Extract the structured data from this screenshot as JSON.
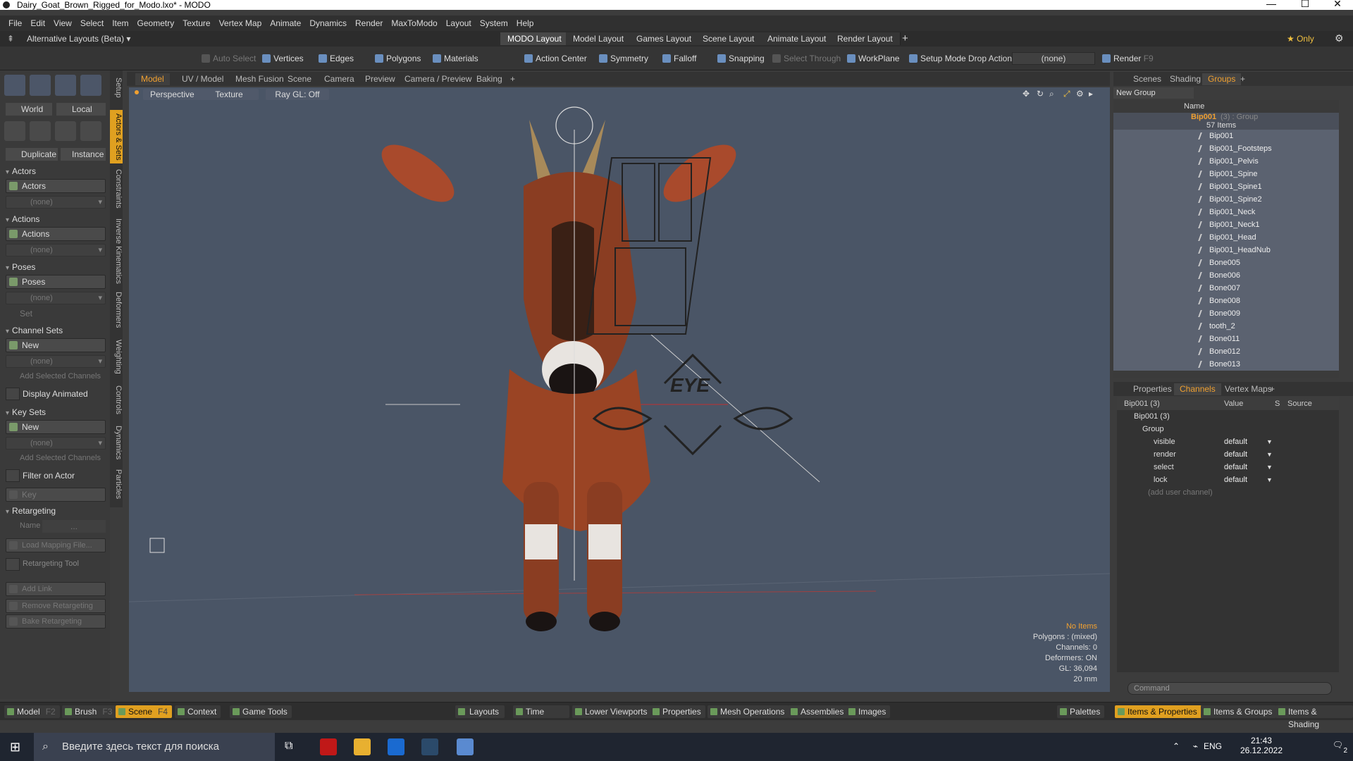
{
  "window": {
    "title": "Dairy_Goat_Brown_Rigged_for_Modo.lxo* - MODO",
    "minimize": "—",
    "maximize": "☐",
    "close": "✕"
  },
  "menu": [
    "File",
    "Edit",
    "View",
    "Select",
    "Item",
    "Geometry",
    "Texture",
    "Vertex Map",
    "Animate",
    "Dynamics",
    "Render",
    "MaxToModo",
    "Layout",
    "System",
    "Help"
  ],
  "layoutbar": {
    "alt": "Alternative Layouts (Beta) ▾",
    "tabs": [
      "MODO Layout",
      "Model Layout",
      "Games Layout",
      "Scene Layout",
      "Animate Layout",
      "Render Layout"
    ],
    "active": 0,
    "add": "+",
    "only": "★ Only"
  },
  "toolbar": {
    "auto_select": "Auto Select",
    "vertices": "Vertices",
    "edges": "Edges",
    "polygons": "Polygons",
    "materials": "Materials",
    "action_center": "Action Center",
    "symmetry": "Symmetry",
    "falloff": "Falloff",
    "snapping": "Snapping",
    "select_through": "Select Through",
    "workplane": "WorkPlane",
    "setup_mode": "Setup Mode",
    "drop_action": "Drop Action",
    "drop_value": "(none)",
    "render": "Render",
    "render_key": "F9"
  },
  "left": {
    "world": "World",
    "local": "Local",
    "duplicate": "Duplicate",
    "instance": "Instance",
    "actors_head": "Actors",
    "actors": "Actors",
    "none": "(none)",
    "actions_head": "Actions",
    "actions": "Actions",
    "poses_head": "Poses",
    "poses": "Poses",
    "set": "Set",
    "channel_sets_head": "Channel Sets",
    "new": "New",
    "add_selected": "Add Selected Channels",
    "display_animated": "Display Animated",
    "key_sets_head": "Key Sets",
    "key": "Key",
    "filter_actor": "Filter on Actor",
    "retargeting_head": "Retargeting",
    "name": "Name",
    "name_val": "...",
    "load_mapping": "Load Mapping File...",
    "retargeting_tool": "Retargeting Tool",
    "add_link": "Add Link",
    "remove_retargeting": "Remove Retargeting",
    "bake_retargeting": "Bake Retargeting"
  },
  "vtabs": [
    "Setup",
    "Actors & Sets",
    "Constraints",
    "Inverse Kinematics",
    "Deformers",
    "Weighting",
    "Controls",
    "Dynamics",
    "Particles"
  ],
  "viewtabs": [
    "Model",
    "UV / Model",
    "Mesh Fusion",
    "Scene",
    "Camera",
    "Preview",
    "Camera / Preview",
    "Baking"
  ],
  "viewport": {
    "perspective": "Perspective",
    "texture": "Texture",
    "raygl": "Ray GL: Off",
    "eye": "EYE",
    "info": {
      "no_items": "No Items",
      "polygons": "Polygons : (mixed)",
      "channels": "Channels: 0",
      "deformers": "Deformers: ON",
      "gl": "GL: 36,094",
      "scale": "20 mm"
    }
  },
  "right": {
    "tabs": [
      "Scenes",
      "Shading",
      "Groups"
    ],
    "new_group": "New Group",
    "col_name": "Name",
    "group": "Bip001",
    "group_meta": "(3) : Group",
    "items_count": "57 Items",
    "items": [
      "Bip001",
      "Bip001_Footsteps",
      "Bip001_Pelvis",
      "Bip001_Spine",
      "Bip001_Spine1",
      "Bip001_Spine2",
      "Bip001_Neck",
      "Bip001_Neck1",
      "Bip001_Head",
      "Bip001_HeadNub",
      "Bone005",
      "Bone006",
      "Bone007",
      "Bone008",
      "Bone009",
      "tooth_2",
      "Bone011",
      "Bone012",
      "Bone013"
    ]
  },
  "props": {
    "tabs": [
      "Properties",
      "Channels",
      "Vertex Maps"
    ],
    "cols": [
      "Bip001 (3)",
      "Value",
      "S",
      "Source"
    ],
    "rows": [
      {
        "n": "Bip001 (3)"
      },
      {
        "n": "Group"
      },
      {
        "n": "visible",
        "v": "default"
      },
      {
        "n": "render",
        "v": "default"
      },
      {
        "n": "select",
        "v": "default"
      },
      {
        "n": "lock",
        "v": "default"
      },
      {
        "n": "(add user channel)"
      }
    ],
    "command": "Command"
  },
  "bottom": {
    "model": "Model",
    "model_k": "F2",
    "brush": "Brush",
    "brush_k": "F3",
    "scene": "Scene",
    "scene_k": "F4",
    "context": "Context",
    "game_tools": "Game Tools",
    "layouts": "Layouts",
    "time": "Time",
    "lower": "Lower Viewports",
    "properties": "Properties",
    "mesh_ops": "Mesh Operations",
    "assemblies": "Assemblies",
    "images": "Images",
    "palettes": "Palettes",
    "items_props": "Items & Properties",
    "items_groups": "Items & Groups",
    "items_shading": "Items & Shading"
  },
  "taskbar": {
    "search": "Введите здесь текст для поиска",
    "lang": "ENG",
    "time": "21:43",
    "date": "26.12.2022",
    "notif": "2"
  }
}
